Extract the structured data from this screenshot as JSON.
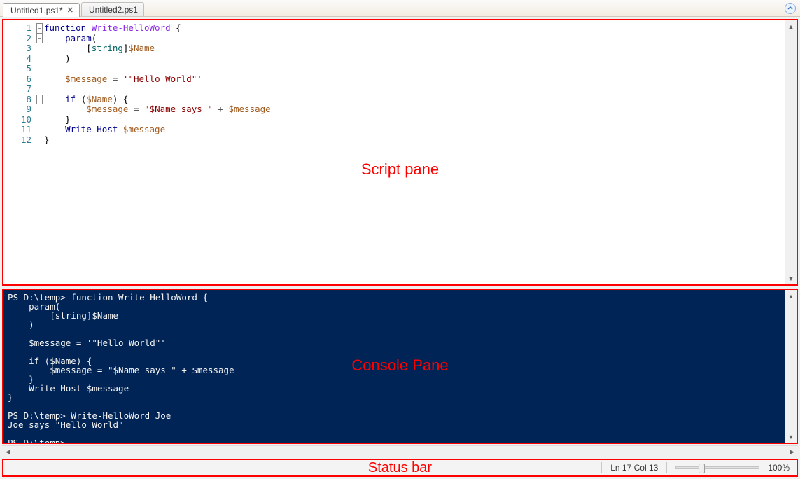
{
  "tabs": {
    "items": [
      {
        "label": "Untitled1.ps1*",
        "active": true,
        "closeable": true
      },
      {
        "label": "Untitled2.ps1",
        "active": false,
        "closeable": false
      }
    ]
  },
  "annotations": {
    "script_pane": "Script pane",
    "console_pane": "Console Pane",
    "status_bar": "Status bar"
  },
  "code_lines": [
    {
      "n": "1",
      "fold": "-",
      "tokens": [
        [
          "kw",
          "function"
        ],
        [
          "",
          " "
        ],
        [
          "fn",
          "Write-HelloWord"
        ],
        [
          "",
          " {"
        ]
      ]
    },
    {
      "n": "2",
      "fold": "-",
      "tokens": [
        [
          "",
          "    "
        ],
        [
          "kw",
          "param"
        ],
        [
          "",
          "("
        ]
      ]
    },
    {
      "n": "3",
      "fold": "",
      "tokens": [
        [
          "",
          "        ["
        ],
        [
          "type",
          "string"
        ],
        [
          "",
          "]"
        ],
        [
          "var",
          "$Name"
        ]
      ]
    },
    {
      "n": "4",
      "fold": "",
      "tokens": [
        [
          "",
          "    )"
        ]
      ]
    },
    {
      "n": "5",
      "fold": "",
      "tokens": [
        [
          "",
          ""
        ]
      ]
    },
    {
      "n": "6",
      "fold": "",
      "tokens": [
        [
          "",
          "    "
        ],
        [
          "var",
          "$message"
        ],
        [
          "",
          " "
        ],
        [
          "op",
          "="
        ],
        [
          "",
          " "
        ],
        [
          "str",
          "'\"Hello World\"'"
        ]
      ]
    },
    {
      "n": "7",
      "fold": "",
      "tokens": [
        [
          "",
          ""
        ]
      ]
    },
    {
      "n": "8",
      "fold": "-",
      "tokens": [
        [
          "",
          "    "
        ],
        [
          "kw",
          "if"
        ],
        [
          "",
          " ("
        ],
        [
          "var",
          "$Name"
        ],
        [
          "",
          ") {"
        ]
      ]
    },
    {
      "n": "9",
      "fold": "",
      "tokens": [
        [
          "",
          "        "
        ],
        [
          "var",
          "$message"
        ],
        [
          "",
          " "
        ],
        [
          "op",
          "="
        ],
        [
          "",
          " "
        ],
        [
          "str",
          "\"$Name says \""
        ],
        [
          "",
          " "
        ],
        [
          "op",
          "+"
        ],
        [
          "",
          " "
        ],
        [
          "var",
          "$message"
        ]
      ]
    },
    {
      "n": "10",
      "fold": "",
      "tokens": [
        [
          "",
          "    }"
        ]
      ]
    },
    {
      "n": "11",
      "fold": "",
      "tokens": [
        [
          "",
          "    "
        ],
        [
          "kw",
          "Write-Host"
        ],
        [
          "",
          " "
        ],
        [
          "var",
          "$message"
        ]
      ]
    },
    {
      "n": "12",
      "fold": "",
      "tokens": [
        [
          "",
          "}"
        ]
      ]
    }
  ],
  "console_text": "PS D:\\temp> function Write-HelloWord {\n    param(\n        [string]$Name\n    )\n\n    $message = '\"Hello World\"'\n\n    if ($Name) {\n        $message = \"$Name says \" + $message\n    }\n    Write-Host $message\n}\n\nPS D:\\temp> Write-HelloWord Joe\nJoe says \"Hello World\"\n\nPS D:\\temp>",
  "status": {
    "position": "Ln 17  Col 13",
    "zoom": "100%"
  }
}
